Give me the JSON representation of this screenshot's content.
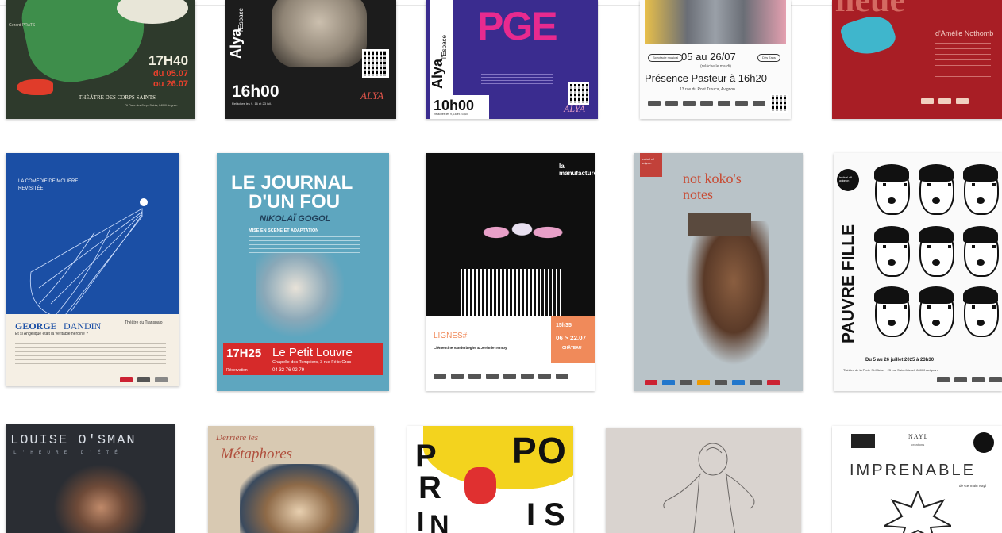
{
  "posters": {
    "p1": {
      "credit_text": "Gérard PRATS",
      "times": [
        "17H40",
        "du 05.07",
        "ou 26.07"
      ],
      "venue": "THÉÂTRE DES CORPS SAINTS",
      "address": "76 Place des Corps Saints, 84000 Avignon"
    },
    "p2": {
      "brand": "Alya",
      "brand_sup": "l'Espace",
      "time": "16h00",
      "relache": "Relâches les 9, 16 et 23 juil.",
      "logo": "ALYA"
    },
    "p3": {
      "title": "PGE",
      "brand": "Alya",
      "brand_sup": "l'Espace",
      "time": "10h00",
      "relache": "Relâches les 9, 16 et 23 juil.",
      "logo": "ALYA"
    },
    "p4": {
      "badge_left": "Spectacle musical",
      "dates": "05 au 26/07",
      "badge_right": "Dès 7ans",
      "relache": "(relâche le mardi)",
      "headline": "Présence Pasteur à 16h20",
      "address": "13 rue du Pont Trouca, Avignon"
    },
    "p5": {
      "title_fragment": "lieue",
      "author": "d'Amélie Nothomb"
    },
    "p6": {
      "tagline": "LA COMÉDIE DE MOLIÈRE REVISITÉE",
      "title_a": "GEORGE",
      "title_b": "DANDIN",
      "subtitle": "Et si Angélique était la véritable héroïne ?",
      "venue": "Théâtre du Transpalo"
    },
    "p7": {
      "title_line1": "LE JOURNAL",
      "title_line2": "D'UN FOU",
      "author": "NIKOLAÏ GOGOL",
      "mise": "MISE EN SCÈNE ET ADAPTATION",
      "time": "17H25",
      "venue": "Le Petit Louvre",
      "address": "Chapelle des Templiers, 3 rue Félix Gras",
      "reservation": "Réservation",
      "phone": "04 32 76 02 79"
    },
    "p8": {
      "brand": "la manufacture",
      "title": "LIGNES#",
      "authors": "Clémentine Vanderbeghe & Jérémie Ternoy",
      "time": "15h35",
      "dates": "06 > 22.07",
      "venue": "CHÂTEAU"
    },
    "p9": {
      "badge": "festival off avignon",
      "title": "not koko's notes"
    },
    "p10": {
      "badge": "festival off avignon",
      "title": "PAUVRE FILLE",
      "info": "Du 5 au 26 juillet 2025 à 23h30",
      "venue": "Théâtre de la Porte St-Michel · 23 rue Saint-Michel, 84000 Avignon"
    },
    "p11": {
      "title": "LOUISE O'SMAN",
      "subtitle": "L'HEURE D'ÉTÉ"
    },
    "p12": {
      "title_line1": "Derrière les",
      "title_line2": "Métaphores"
    },
    "p13": {
      "letters_left": [
        "P",
        "R",
        "I",
        "N"
      ],
      "letters_right": [
        "P",
        "O",
        "I",
        "S"
      ]
    },
    "p14": {},
    "p15": {
      "logo_mid": "NAYL",
      "logo_mid_sub": "créations",
      "title": "IMPRENABLE",
      "author": "de Germain Nayl"
    }
  },
  "colors": {
    "p1_bg": "#2e3a2c",
    "p1_green": "#3e8e4b",
    "p1_red": "#e03c2a",
    "p3_bg": "#3a2c8f",
    "p3_pink": "#e82a8f",
    "p5_bg": "#a81e25",
    "p6_bg": "#1b4fa5",
    "p7_bg": "#5ea6bf",
    "p7_red": "#d62a2a",
    "p8_orange": "#f08a5a",
    "p9_bg": "#b9c3c8",
    "p11_bg": "#2a2d33",
    "p13_yellow": "#f3d31e"
  }
}
